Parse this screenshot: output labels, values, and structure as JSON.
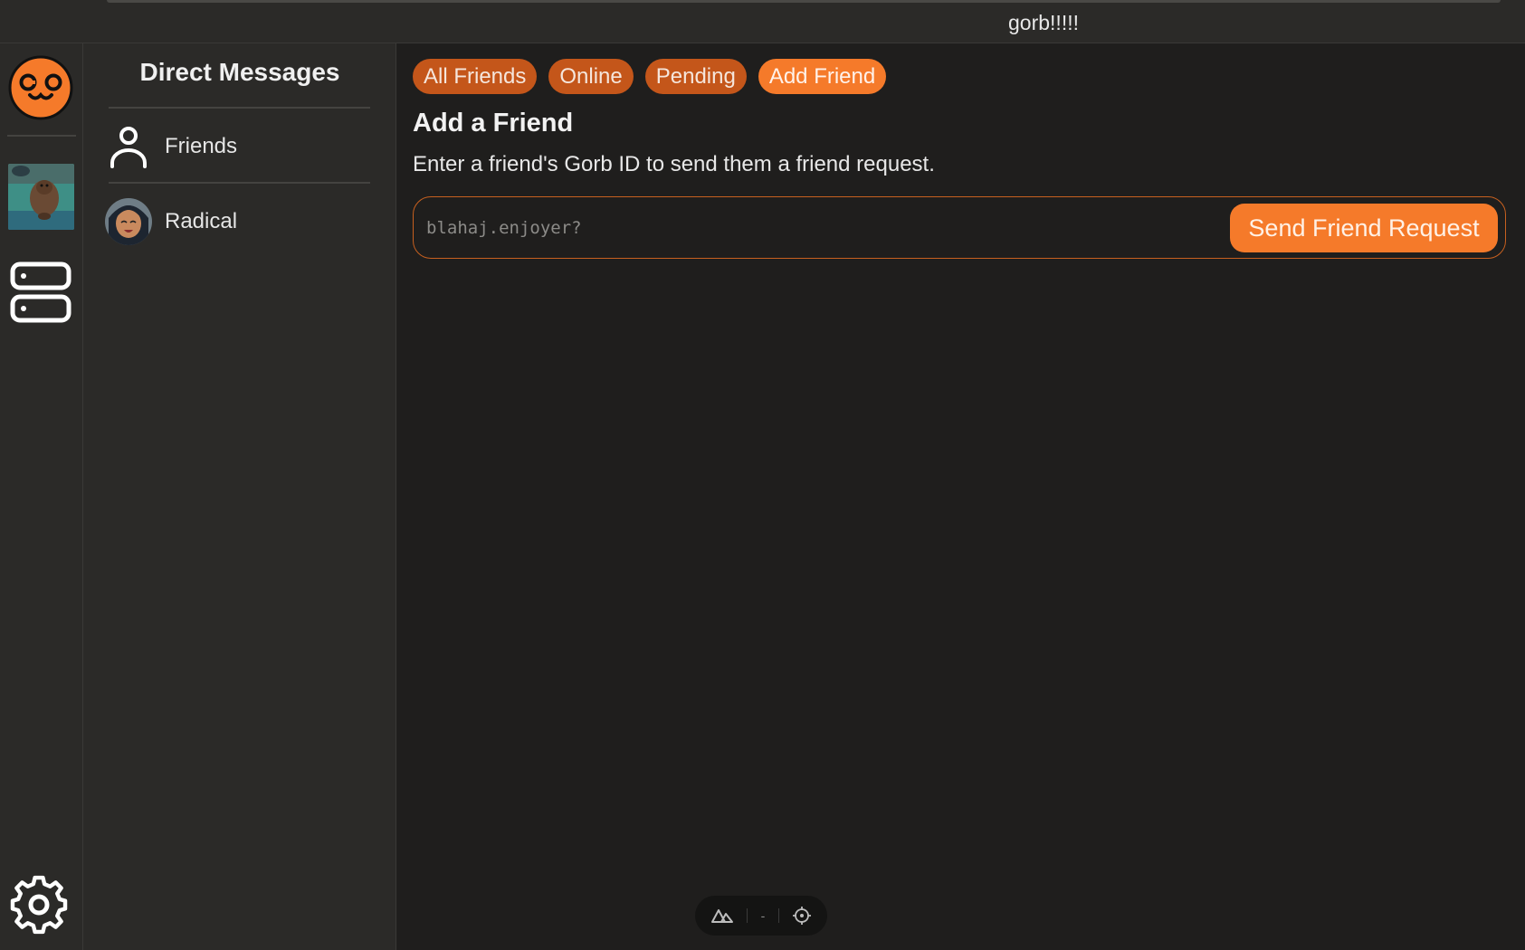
{
  "topbar": {
    "title": "gorb!!!!!"
  },
  "rail": {
    "icons": {
      "logo": "cat-logo-icon",
      "guild": "guild-beaver-avatar",
      "servers": "server-stack-icon",
      "settings": "gear-icon"
    }
  },
  "dm_panel": {
    "heading": "Direct Messages",
    "items": [
      {
        "label": "Friends",
        "icon": "user-icon"
      },
      {
        "label": "Radical",
        "icon": "avatar"
      }
    ]
  },
  "main": {
    "tabs": [
      {
        "label": "All Friends",
        "active": false
      },
      {
        "label": "Online",
        "active": false
      },
      {
        "label": "Pending",
        "active": false
      },
      {
        "label": "Add Friend",
        "active": true
      }
    ],
    "title": "Add a Friend",
    "description": "Enter a friend's Gorb ID to send them a friend request.",
    "input": {
      "value": "",
      "placeholder": "blahaj.enjoyer?"
    },
    "send_label": "Send Friend Request"
  },
  "devbar": {
    "separator_text": "-"
  },
  "colors": {
    "accent": "#f57a2a",
    "tab": "#c4561a",
    "background": "#1f1e1d",
    "panel": "#2b2a28"
  }
}
